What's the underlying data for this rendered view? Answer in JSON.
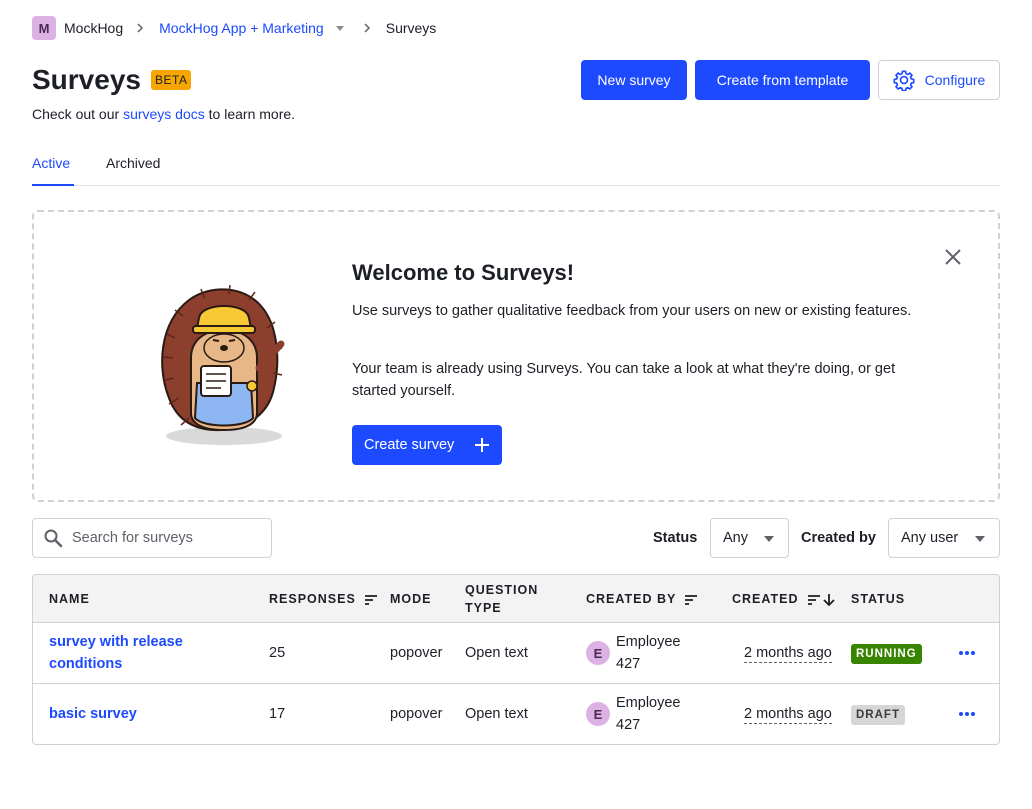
{
  "breadcrumb": {
    "org_initial": "M",
    "org_name": "MockHog",
    "project_name": "MockHog App + Marketing",
    "current": "Surveys"
  },
  "header": {
    "title": "Surveys",
    "badge": "BETA",
    "subtitle_prefix": "Check out our ",
    "subtitle_link": "surveys docs",
    "subtitle_suffix": " to learn more.",
    "new_survey_label": "New survey",
    "create_template_label": "Create from template",
    "configure_label": "Configure"
  },
  "tabs": [
    {
      "label": "Active",
      "active": true
    },
    {
      "label": "Archived",
      "active": false
    }
  ],
  "welcome": {
    "title": "Welcome to Surveys!",
    "paragraph1": "Use surveys to gather qualitative feedback from your users on new or existing features.",
    "paragraph2": "Your team is already using Surveys. You can take a look at what they're doing, or get started yourself.",
    "create_label": "Create survey"
  },
  "filters": {
    "search_placeholder": "Search for surveys",
    "status_label": "Status",
    "status_value": "Any",
    "created_by_label": "Created by",
    "created_by_value": "Any user"
  },
  "table": {
    "columns": {
      "name": "NAME",
      "responses": "RESPONSES",
      "mode": "MODE",
      "question_type_line1": "QUESTION",
      "question_type_line2": "TYPE",
      "created_by": "CREATED BY",
      "created": "CREATED",
      "status": "STATUS"
    },
    "rows": [
      {
        "name": "survey with release conditions",
        "responses": "25",
        "mode": "popover",
        "question_type": "Open text",
        "creator_initial": "E",
        "creator_line1": "Employee",
        "creator_line2": "427",
        "created": "2 months ago",
        "status": "RUNNING"
      },
      {
        "name": "basic survey",
        "responses": "17",
        "mode": "popover",
        "question_type": "Open text",
        "creator_initial": "E",
        "creator_line1": "Employee",
        "creator_line2": "427",
        "created": "2 months ago",
        "status": "DRAFT"
      }
    ]
  },
  "colors": {
    "accent": "#1d4aff",
    "beta": "#f7a501",
    "running": "#388600",
    "draft": "#d6d6d6",
    "avatar": "#dcb1e3"
  },
  "icons": [
    "chevron-right-icon",
    "caret-down-icon",
    "gear-icon",
    "close-icon",
    "plus-icon",
    "search-icon",
    "sort-icon",
    "sort-desc-icon",
    "more-icon"
  ]
}
